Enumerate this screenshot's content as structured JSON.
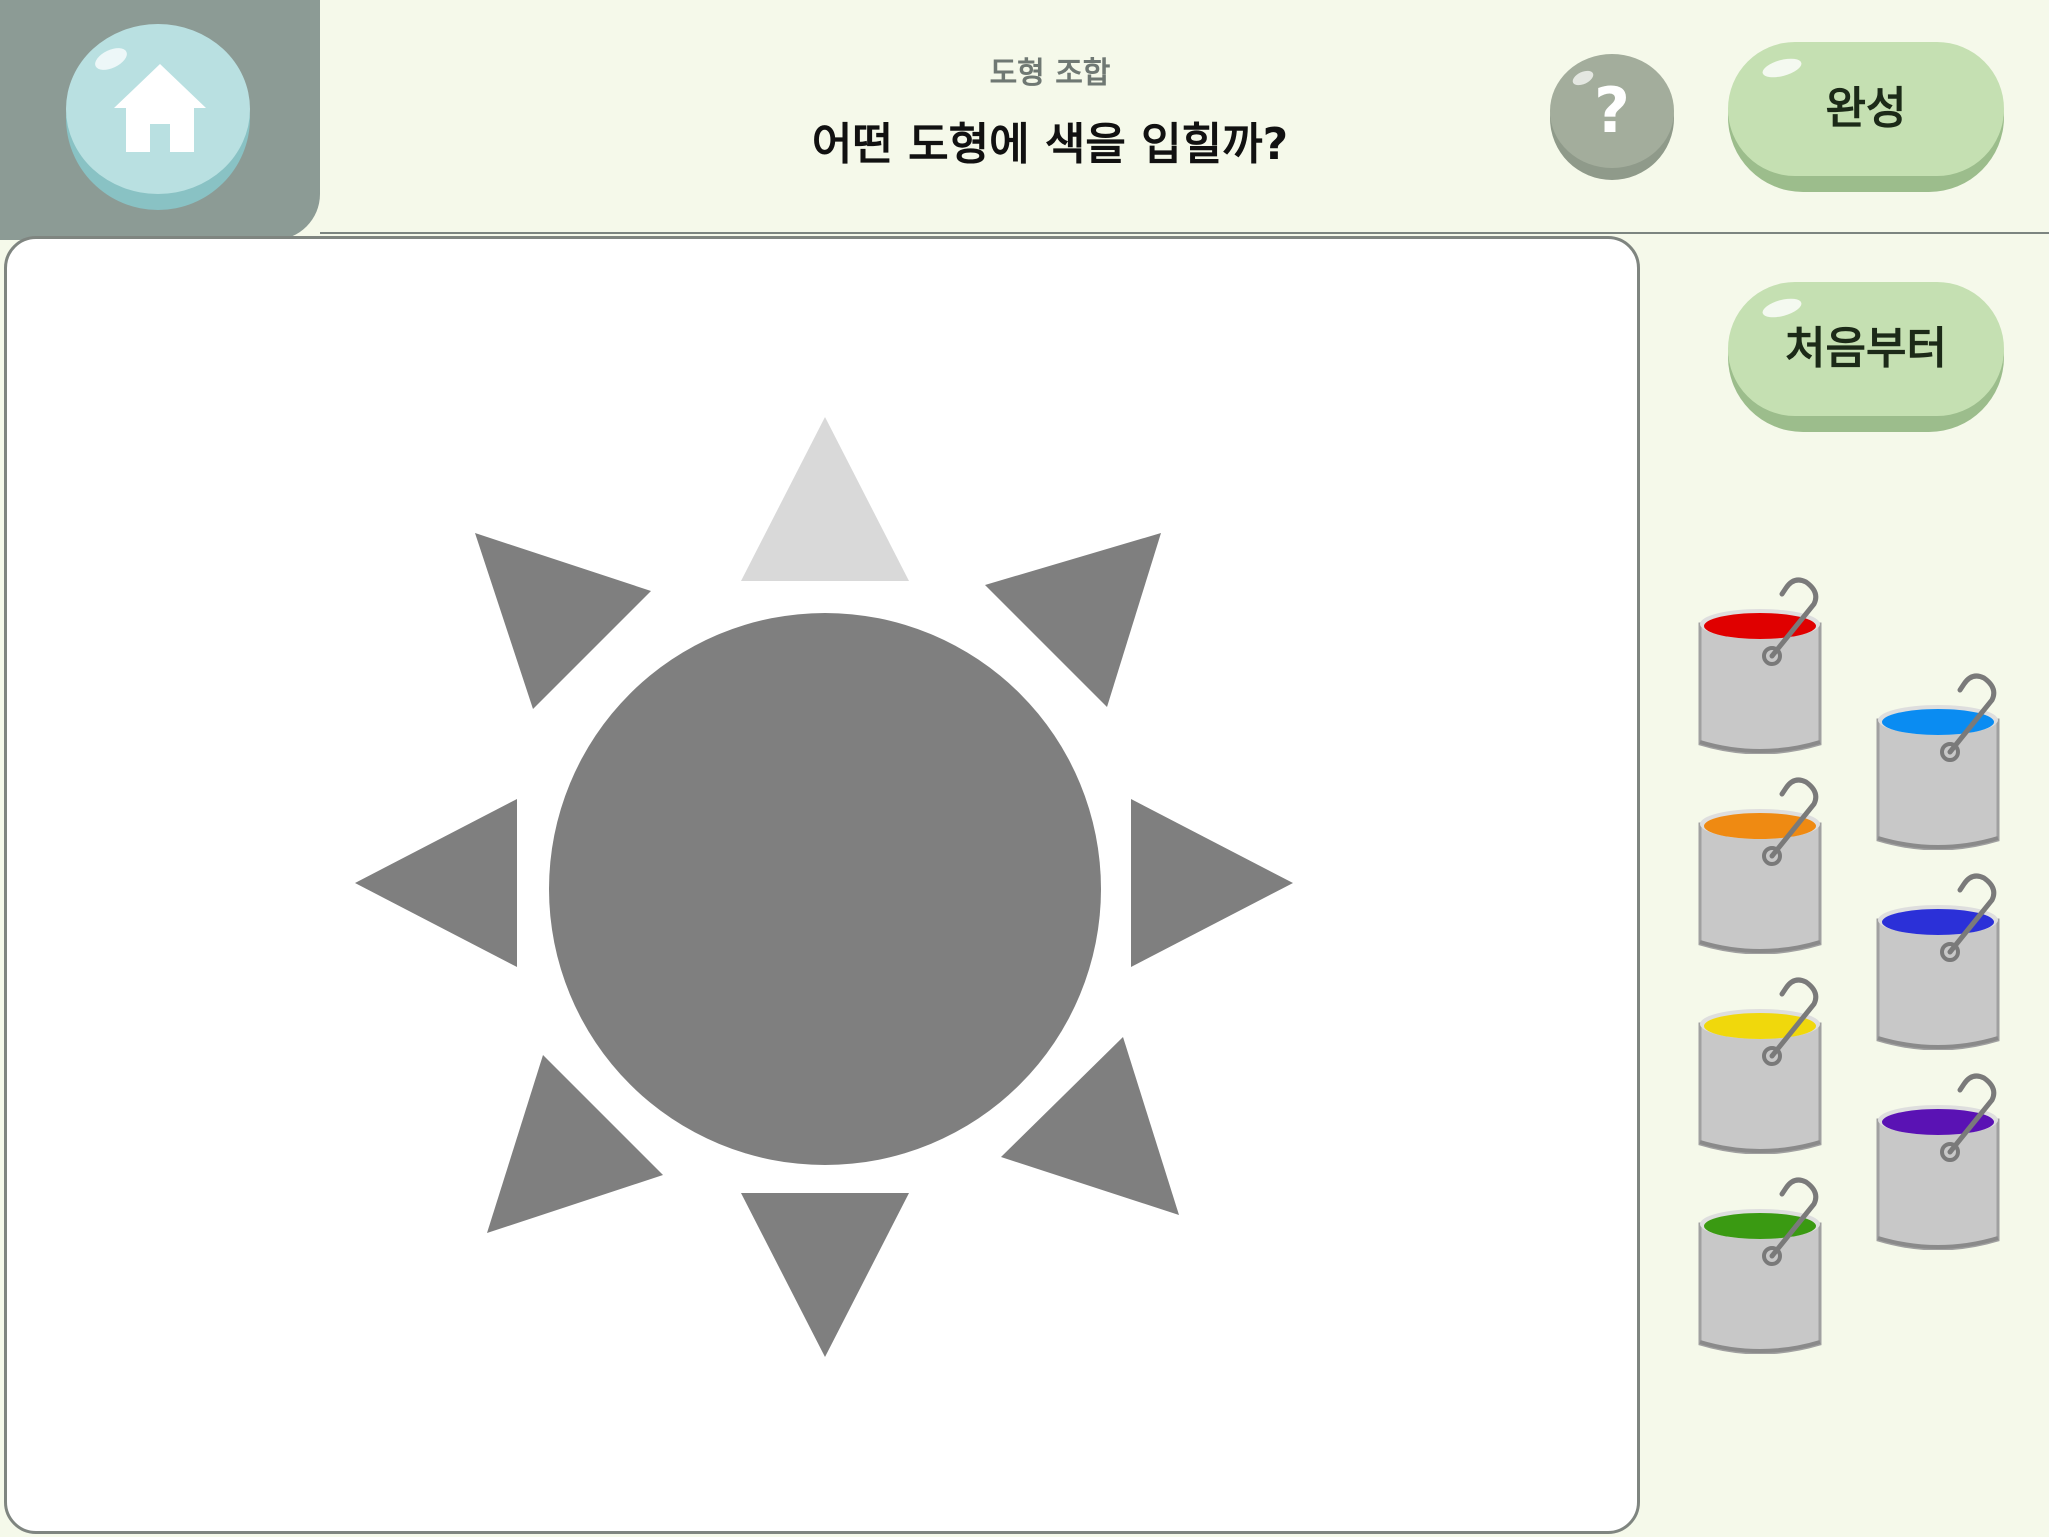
{
  "header": {
    "subtitle": "도형 조합",
    "title": "어떤 도형에 색을 입힐까?",
    "help_label": "?",
    "done_label": "완성",
    "reset_label": "처음부터"
  },
  "icons": {
    "home": "home-icon",
    "help": "question-icon",
    "bucket": "paint-bucket-icon"
  },
  "colors": {
    "header_bg": "#f5f9ea",
    "home_tab": "#8c9b95",
    "home_button": "#b9e0e1",
    "green_button": "#c5e0b2",
    "shape_fill": "#7f7f7f",
    "shape_selected": "#d9d9d9",
    "bucket_body": "#c8c8c8"
  },
  "paints": [
    {
      "name": "red",
      "color": "#e00000"
    },
    {
      "name": "orange",
      "color": "#ef8a12"
    },
    {
      "name": "yellow",
      "color": "#f0d80c"
    },
    {
      "name": "green",
      "color": "#3a9a12"
    },
    {
      "name": "sky-blue",
      "color": "#0a8cf2"
    },
    {
      "name": "blue",
      "color": "#2b30d8"
    },
    {
      "name": "purple",
      "color": "#5a12b4"
    }
  ]
}
